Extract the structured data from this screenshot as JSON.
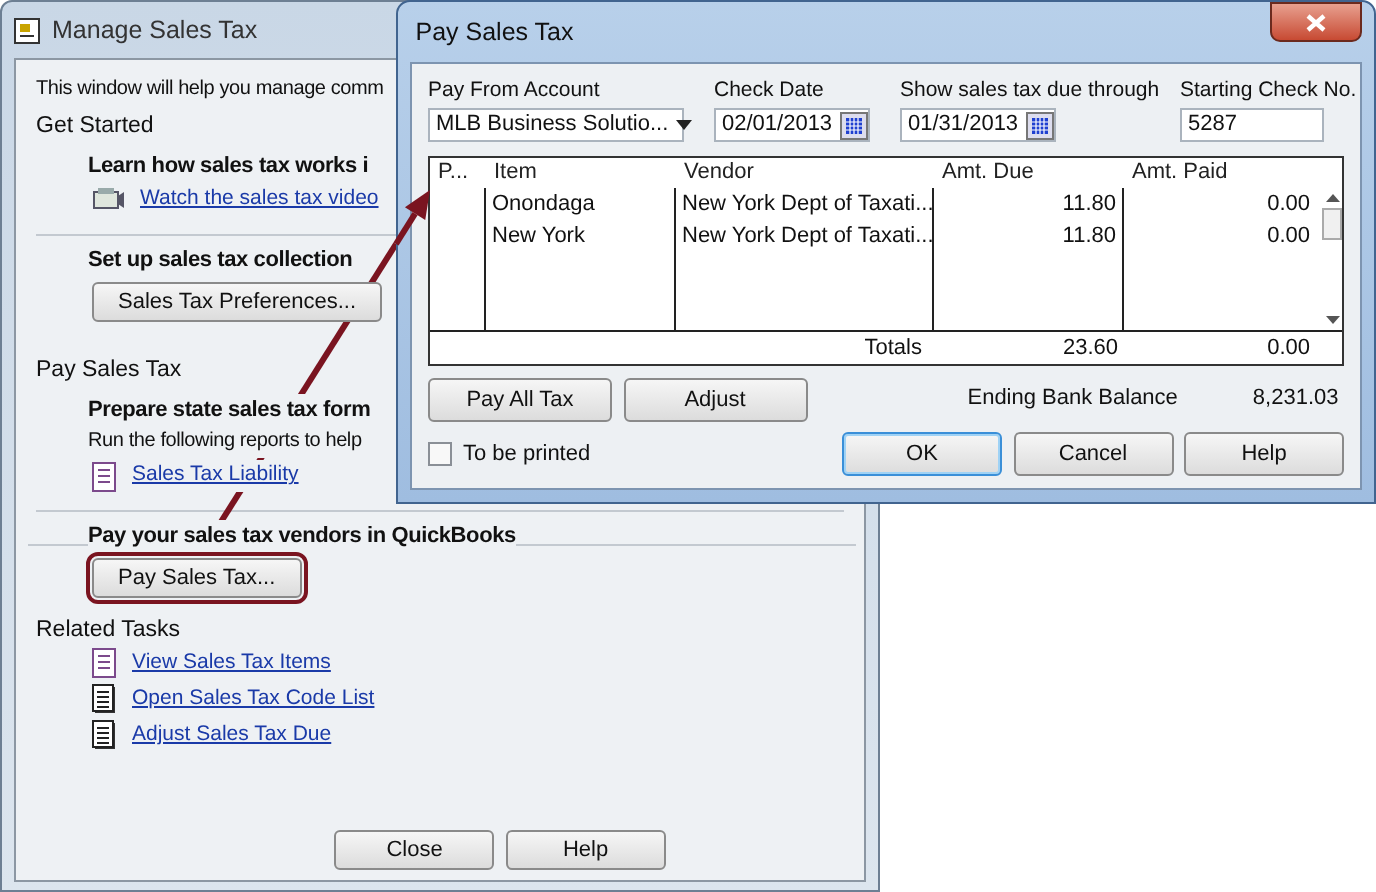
{
  "manage_window": {
    "title": "Manage Sales Tax",
    "intro": "This window will help you manage comm",
    "sections": [
      {
        "heading": "Get Started",
        "groups": [
          {
            "title": "Learn how sales tax works i",
            "links": [
              {
                "kind": "video",
                "label": "Watch the sales tax video"
              }
            ]
          },
          {
            "title": "Set up sales tax collection",
            "button": {
              "label": "Sales Tax Preferences...",
              "highlighted": false
            }
          }
        ]
      },
      {
        "heading": "Pay Sales Tax",
        "groups": [
          {
            "title": "Prepare state sales tax form",
            "note": "Run the following reports to help",
            "links": [
              {
                "kind": "report",
                "label": "Sales Tax Liability"
              }
            ]
          },
          {
            "title": "Pay your sales tax vendors in QuickBooks",
            "button": {
              "label": "Pay Sales Tax...",
              "highlighted": true
            }
          }
        ]
      },
      {
        "heading": "Related Tasks",
        "groups": [
          {
            "links": [
              {
                "kind": "report",
                "label": "View Sales Tax Items"
              },
              {
                "kind": "list",
                "label": "Open Sales Tax Code List"
              },
              {
                "kind": "list",
                "label": "Adjust Sales Tax Due"
              }
            ]
          }
        ]
      }
    ],
    "buttons": [
      "Close",
      "Help"
    ]
  },
  "pay_dialog": {
    "title": "Pay Sales Tax",
    "fields": [
      {
        "label": "Pay From Account",
        "value": "MLB Business Solutio...",
        "kind": "dropdown"
      },
      {
        "label": "Check Date",
        "value": "02/01/2013",
        "kind": "date"
      },
      {
        "label": "Show sales tax due through",
        "value": "01/31/2013",
        "kind": "date"
      },
      {
        "label": "Starting Check No.",
        "value": "5287",
        "kind": "text"
      }
    ],
    "table": {
      "columns": [
        "P...",
        "Item",
        "Vendor",
        "Amt. Due",
        "Amt. Paid"
      ],
      "rows": [
        {
          "item": "Onondaga",
          "vendor": "New York Dept of Taxati...",
          "amt_due": "11.80",
          "amt_paid": "0.00"
        },
        {
          "item": "New York",
          "vendor": "New York Dept of Taxati...",
          "amt_due": "11.80",
          "amt_paid": "0.00"
        }
      ],
      "totals": {
        "label": "Totals",
        "amt_due": "23.60",
        "amt_paid": "0.00"
      }
    },
    "actions": [
      "Pay All Tax",
      "Adjust"
    ],
    "ending_balance": {
      "label": "Ending Bank Balance",
      "value": "8,231.03"
    },
    "to_be_printed": {
      "label": "To be printed",
      "checked": false
    },
    "buttons": [
      {
        "label": "OK",
        "default": true
      },
      {
        "label": "Cancel",
        "default": false
      },
      {
        "label": "Help",
        "default": false
      }
    ]
  }
}
